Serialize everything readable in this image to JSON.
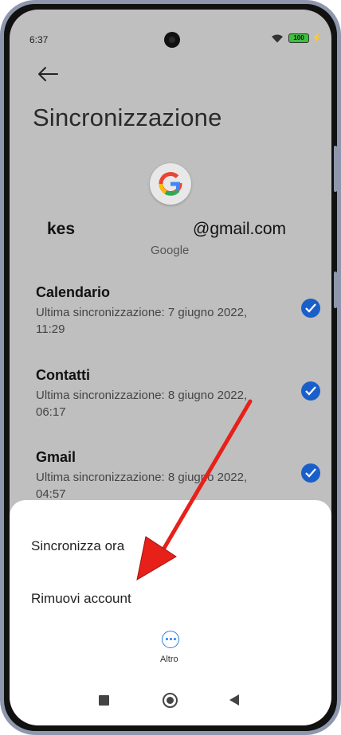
{
  "status_bar": {
    "time": "6:37",
    "battery": "100"
  },
  "header": {
    "title": "Sincronizzazione"
  },
  "account": {
    "email_prefix": "kes",
    "email_suffix": "@gmail.com",
    "type": "Google"
  },
  "sync_items": [
    {
      "title": "Calendario",
      "subtitle": "Ultima sincronizzazione: 7 giugno 2022, 11:29",
      "checked": true
    },
    {
      "title": "Contatti",
      "subtitle": "Ultima sincronizzazione: 8 giugno 2022, 06:17",
      "checked": true
    },
    {
      "title": "Gmail",
      "subtitle": "Ultima sincronizzazione: 8 giugno 2022, 04:57",
      "checked": true
    }
  ],
  "sheet": {
    "items": [
      "Sincronizza ora",
      "Rimuovi account"
    ],
    "more_label": "Altro"
  },
  "colors": {
    "accent": "#1a5fc9",
    "annotation": "#e8201a"
  }
}
